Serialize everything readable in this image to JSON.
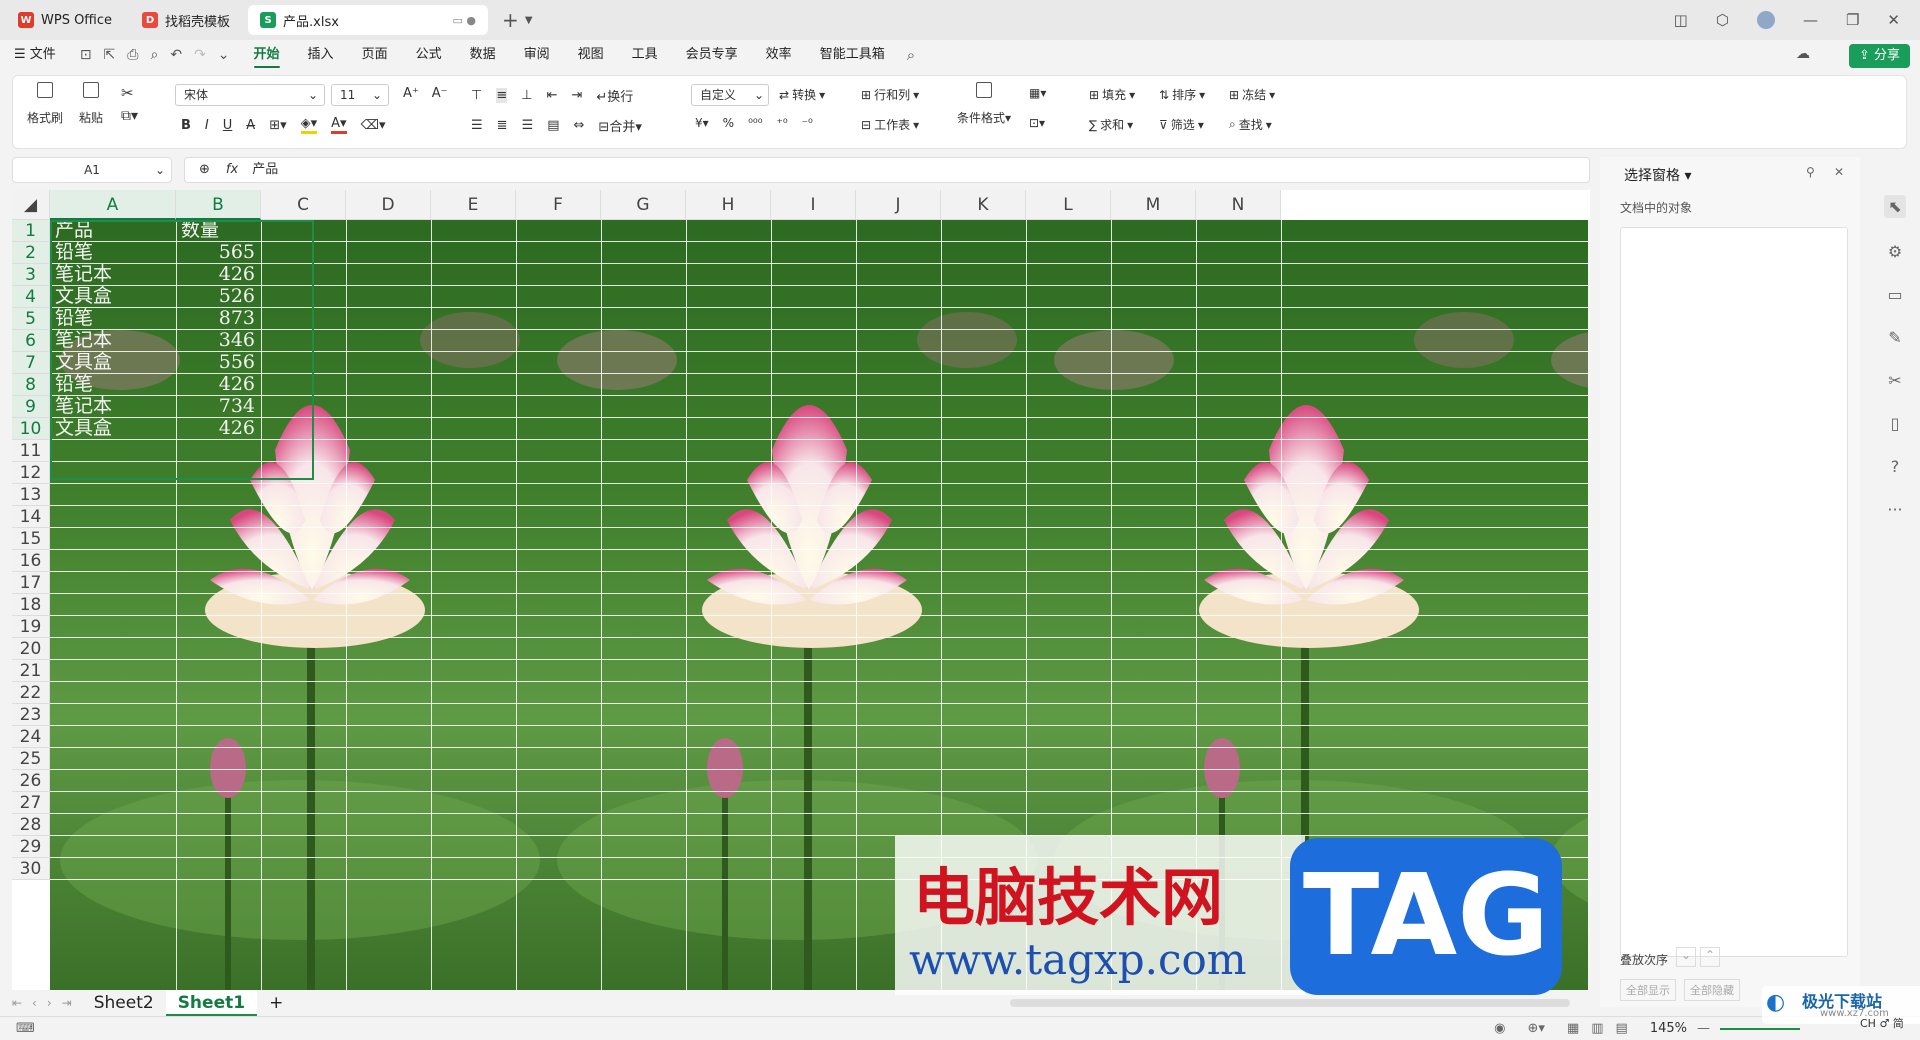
{
  "window_tabs": [
    {
      "label": "WPS Office",
      "icon": "wps-logo-icon"
    },
    {
      "label": "找稻壳模板",
      "icon": "docer-icon"
    },
    {
      "label": "产品.xlsx",
      "icon": "sheet-file-icon"
    }
  ],
  "menu": {
    "file": "文件",
    "items": [
      "开始",
      "插入",
      "页面",
      "公式",
      "数据",
      "审阅",
      "视图",
      "工具",
      "会员专享",
      "效率",
      "智能工具箱"
    ],
    "active": "开始",
    "share": "分享"
  },
  "ribbon": {
    "format_painter": "格式刷",
    "paste": "粘贴",
    "font_name": "宋体",
    "font_size": "11",
    "wrap": "换行",
    "merge": "合并",
    "number_format": "自定义",
    "convert": "转换",
    "row_col": "行和列",
    "worksheet": "工作表",
    "cond_format": "条件格式",
    "fill": "填充",
    "sort": "排序",
    "freeze": "冻结",
    "sum": "求和",
    "filter": "筛选",
    "find": "查找"
  },
  "formula_bar": {
    "name_box": "A1",
    "fx": "fx",
    "content": "产品"
  },
  "columns": [
    "A",
    "B",
    "C",
    "D",
    "E",
    "F",
    "G",
    "H",
    "I",
    "J",
    "K",
    "L",
    "M",
    "N"
  ],
  "rows": [
    "1",
    "2",
    "3",
    "4",
    "5",
    "6",
    "7",
    "8",
    "9",
    "10",
    "11",
    "12",
    "13",
    "14",
    "15",
    "16",
    "17",
    "18",
    "19",
    "20",
    "21",
    "22",
    "23",
    "24",
    "25",
    "26",
    "27",
    "28",
    "29",
    "30"
  ],
  "table": {
    "headers": [
      "产品",
      "数量"
    ],
    "data": [
      [
        "铅笔",
        "565"
      ],
      [
        "笔记本",
        "426"
      ],
      [
        "文具盒",
        "526"
      ],
      [
        "铅笔",
        "873"
      ],
      [
        "笔记本",
        "346"
      ],
      [
        "文具盒",
        "556"
      ],
      [
        "铅笔",
        "426"
      ],
      [
        "笔记本",
        "734"
      ],
      [
        "文具盒",
        "426"
      ]
    ]
  },
  "selection_pane": {
    "title": "选择窗格",
    "subtitle": "文档中的对象",
    "order_label": "叠放次序",
    "show_all": "全部显示",
    "hide_all": "全部隐藏"
  },
  "sheet_tabs": [
    "Sheet2",
    "Sheet1"
  ],
  "active_sheet": "Sheet1",
  "add_sheet": "+",
  "status": {
    "zoom": "145%"
  },
  "watermark": {
    "cn": "电脑技术网",
    "url": "www.tagxp.com",
    "tag": "TAG",
    "corner": "极光下载站",
    "corner_url": "www.xz7.com",
    "ime": "CH ♂ 简"
  },
  "colors": {
    "accent": "#147a44",
    "share_bg": "#1a9d5a"
  }
}
